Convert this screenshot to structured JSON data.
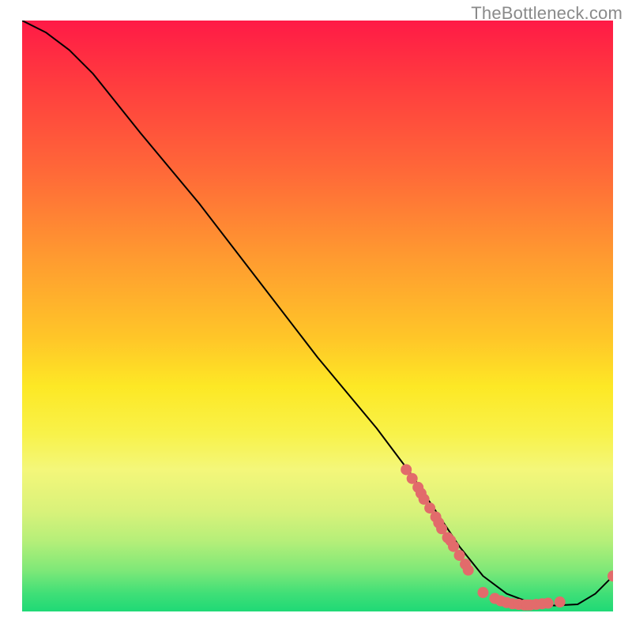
{
  "watermark": "TheBottleneck.com",
  "chart_data": {
    "type": "line",
    "title": "",
    "xlabel": "",
    "ylabel": "",
    "xlim": [
      0,
      100
    ],
    "ylim": [
      0,
      100
    ],
    "grid": false,
    "legend": false,
    "series": [
      {
        "name": "curve",
        "style": "line",
        "color": "#000000",
        "x": [
          0,
          4,
          8,
          12,
          20,
          30,
          40,
          50,
          60,
          66,
          70,
          74,
          78,
          82,
          86,
          90,
          94,
          97,
          100
        ],
        "y": [
          100,
          98,
          95,
          91,
          81,
          69,
          56,
          43,
          31,
          23,
          17,
          11,
          6,
          3,
          1.5,
          1,
          1.2,
          3,
          6
        ]
      },
      {
        "name": "upper-cluster",
        "style": "scatter",
        "color": "#e26b6b",
        "x": [
          65,
          66,
          67,
          67.5,
          68,
          69,
          70,
          70.5,
          71,
          72,
          72.5,
          73,
          74,
          75,
          75.5
        ],
        "y": [
          24,
          22.5,
          21,
          20,
          19,
          17.5,
          16,
          15,
          14,
          12.5,
          12,
          11,
          9.5,
          8,
          7
        ]
      },
      {
        "name": "valley-cluster",
        "style": "scatter",
        "color": "#e26b6b",
        "x": [
          78,
          80,
          81,
          82,
          83,
          84,
          85,
          85.5,
          86,
          87,
          88,
          89,
          91
        ],
        "y": [
          3.2,
          2.2,
          1.8,
          1.5,
          1.3,
          1.2,
          1.1,
          1.1,
          1.1,
          1.2,
          1.3,
          1.4,
          1.6
        ]
      },
      {
        "name": "tail-dot",
        "style": "scatter",
        "color": "#e26b6b",
        "x": [
          100
        ],
        "y": [
          6
        ]
      }
    ]
  }
}
